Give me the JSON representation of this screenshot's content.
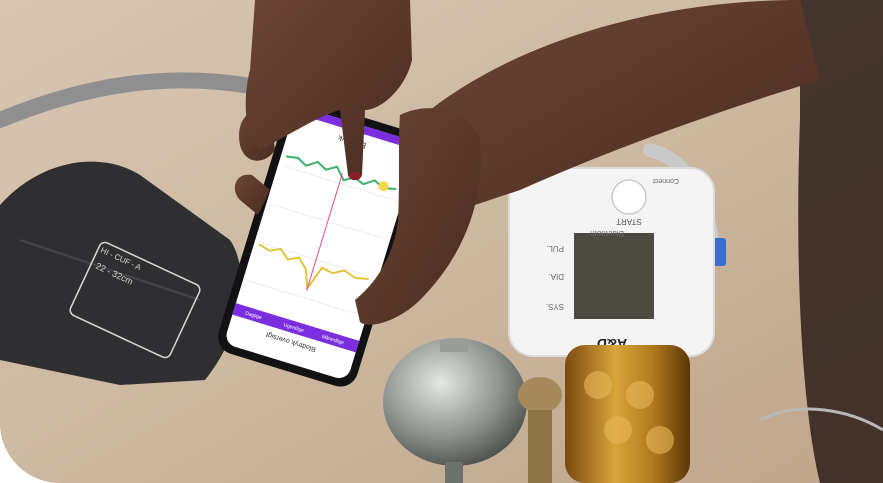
{
  "photo": {
    "monitor": {
      "button_label": "START",
      "brand_mark": "Connect",
      "bluetooth_label": "Bluetooth",
      "readout_labels": [
        "SYS.",
        "DIA.",
        "PUL."
      ],
      "logo": "A&D"
    },
    "cuff": {
      "size_text": "22 - 32cm",
      "model_text": "HI - CUF - A"
    },
    "phone": {
      "header_text": "Blodtryk",
      "tabs": [
        "Daglige",
        "Ugentlige",
        "Månedlige"
      ],
      "footer_text": "Blodtryk oversigt",
      "colors": {
        "accent": "#7b2ee0",
        "systolic_line": "#3ab36a",
        "diastolic_line": "#e0c53a",
        "marker": "#e24c8a"
      }
    }
  }
}
